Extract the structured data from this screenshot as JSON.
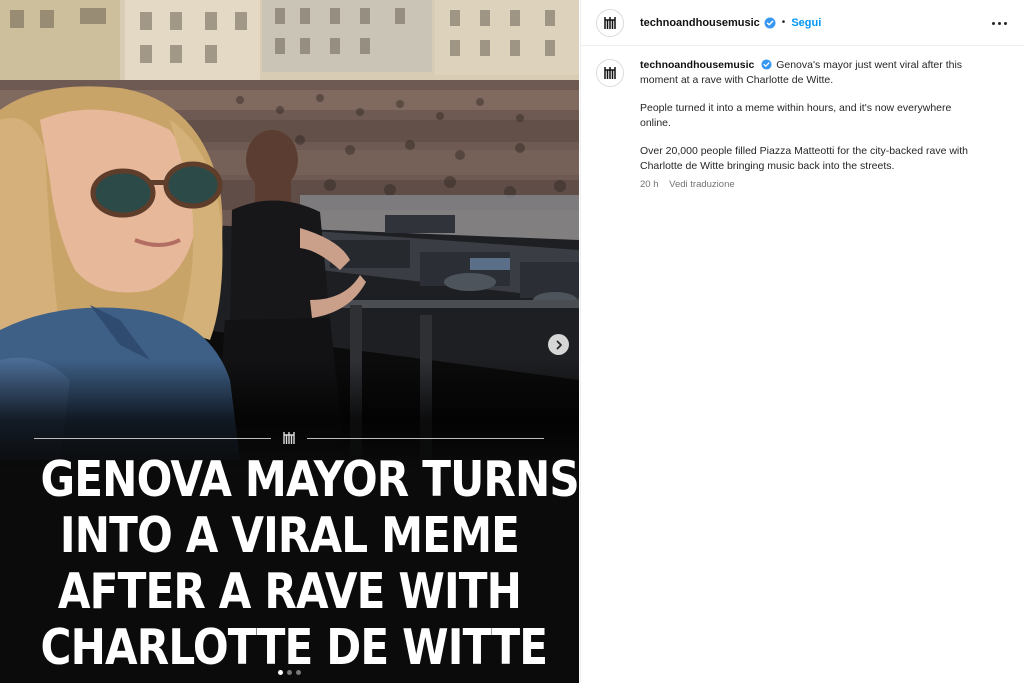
{
  "post": {
    "username": "technoandhousemusic",
    "follow_label": "Segui",
    "separator": "•",
    "caption_paragraphs": [
      "Genova's mayor just went viral after this moment at a rave with Charlotte de Witte.",
      "People turned it into a meme within hours, and it's now everywhere online.",
      "Over 20,000 people filled Piazza Matteotti for the city-backed rave with Charlotte de Witte bringing music back into the streets."
    ],
    "time": "20 h",
    "translate_label": "Vedi traduzione"
  },
  "media": {
    "headline_lines": [
      "GENOVA MAYOR TURNS",
      "INTO A VIRAL MEME",
      "AFTER A RAVE WITH",
      "CHARLOTTE DE WITTE"
    ],
    "carousel_count": 3,
    "carousel_active_index": 0
  },
  "colors": {
    "follow_blue": "#0095f6",
    "verified_blue": "#3897f0",
    "media_background": "#0b0b0b"
  },
  "icons": [
    "brand-logo-icon",
    "verified-badge-icon",
    "more-options-icon",
    "chevron-right-icon"
  ]
}
